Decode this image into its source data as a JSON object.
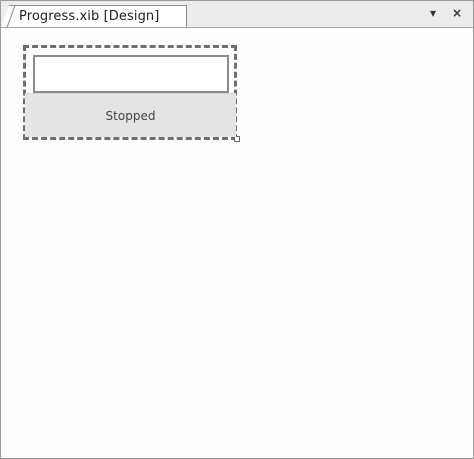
{
  "document_tab": {
    "label": "Progress.xib [Design]"
  },
  "tabstrip": {
    "pin_glyph": "▾",
    "close_glyph": "×"
  },
  "design_surface": {
    "text_input_value": "",
    "status_button_label": "Stopped"
  },
  "colors": {
    "selection_border": "#6f6f6f",
    "button_background": "#e4e4e4"
  }
}
